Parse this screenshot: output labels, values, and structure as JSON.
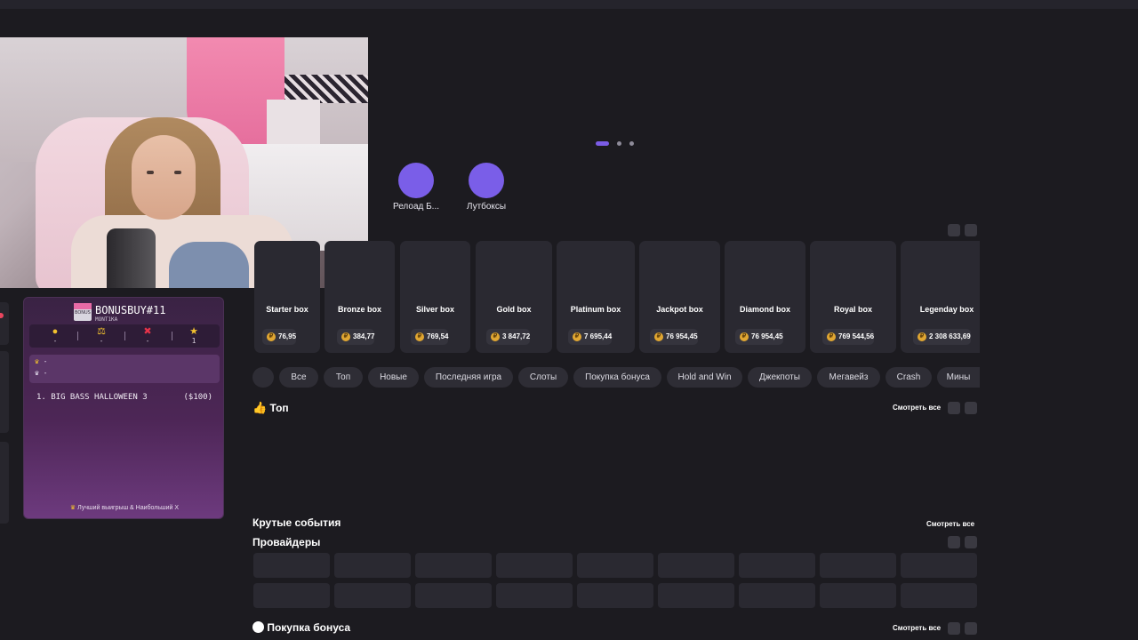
{
  "bonus_panel": {
    "badge_label": "BONUS",
    "title": "BONUSBUY#11",
    "subtitle": "MONT1KA",
    "stats": [
      {
        "icon": "coin-icon",
        "value": "-"
      },
      {
        "icon": "scales-icon",
        "value": "-"
      },
      {
        "icon": "cross-icon",
        "value": "-"
      },
      {
        "icon": "star-icon",
        "value": "1"
      }
    ],
    "best_rows": [
      "-",
      "-"
    ],
    "entries": [
      {
        "name": "1. BIG BASS HALLOWEEN 3",
        "amount": "($100)"
      }
    ],
    "footer": "Лучший выигрыш & Наибольший X"
  },
  "quick_links": [
    {
      "label": "Релоад Б..."
    },
    {
      "label": "Лутбоксы"
    }
  ],
  "boxes": [
    {
      "name": "Starter box",
      "price": "76,95"
    },
    {
      "name": "Bronze box",
      "price": "384,77"
    },
    {
      "name": "Silver box",
      "price": "769,54"
    },
    {
      "name": "Gold box",
      "price": "3 847,72"
    },
    {
      "name": "Platinum box",
      "price": "7 695,44"
    },
    {
      "name": "Jackpot box",
      "price": "76 954,45"
    },
    {
      "name": "Diamond box",
      "price": "76 954,45"
    },
    {
      "name": "Royal box",
      "price": "769 544,56"
    },
    {
      "name": "Legenday box",
      "price": "2 308 633,69"
    }
  ],
  "categories": [
    "Все",
    "Топ",
    "Новые",
    "Последняя игра",
    "Слоты",
    "Покупка бонуса",
    "Hold and Win",
    "Джекпоты",
    "Мегавейз",
    "Crash",
    "Мины"
  ],
  "sections": {
    "top": {
      "title": "Топ",
      "see_all": "Смотреть все"
    },
    "events": {
      "title": "Крутые события",
      "see_all": "Смотреть все"
    },
    "providers": {
      "title": "Провайдеры"
    },
    "bonus_buy": {
      "title": "Покупка бонуса",
      "see_all": "Смотреть все"
    }
  },
  "colors": {
    "accent": "#7a5ee8",
    "background": "#1c1b20",
    "card": "#2a2931",
    "coin": "#e1a732"
  }
}
